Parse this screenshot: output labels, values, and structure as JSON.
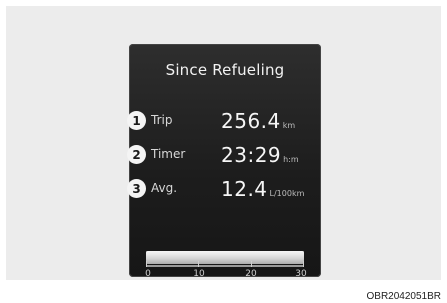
{
  "screen": {
    "title": "Since Refueling",
    "rows": [
      {
        "num": "1",
        "label": "Trip",
        "value": "256.4",
        "unit": "km"
      },
      {
        "num": "2",
        "label": "Timer",
        "value": "23:29",
        "unit": "h:m"
      },
      {
        "num": "3",
        "label": "Avg.",
        "value": "12.4",
        "unit": "L/100km"
      }
    ],
    "gauge": {
      "ticks": [
        "0",
        "10",
        "20",
        "30"
      ],
      "fill_fraction": 1.0
    }
  },
  "caption": "OBR2042051BR"
}
